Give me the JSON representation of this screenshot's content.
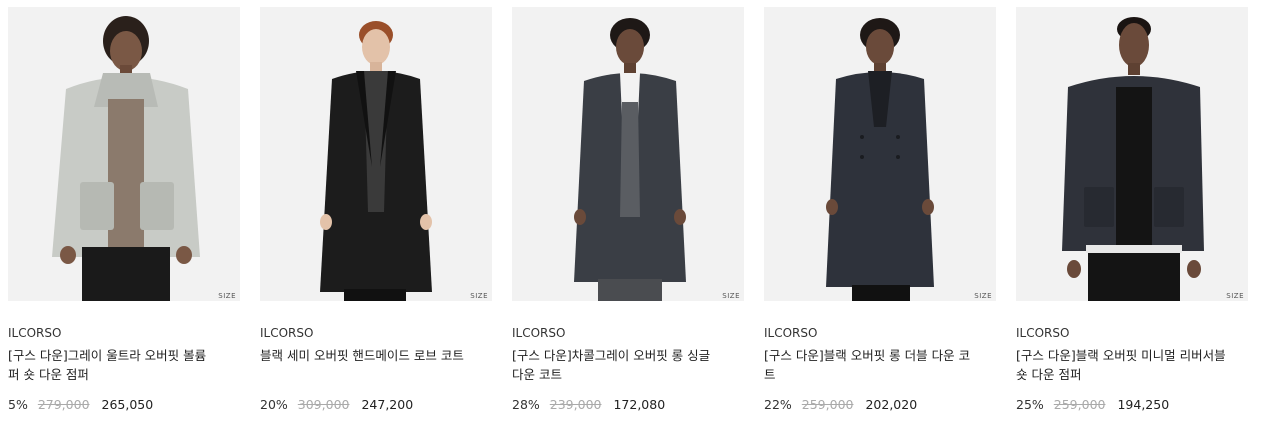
{
  "size_label": "SIZE",
  "products": [
    {
      "brand": "ILCORSO",
      "name": "[구스 다운]그레이 울트라 오버핏 볼륨 퍼 숏 다운 점퍼",
      "discount": "5%",
      "original_price": "279,000",
      "sale_price": "265,050",
      "garment_color": "#c8cbc6",
      "inner_color": "#8b7a6c",
      "type": "puffer"
    },
    {
      "brand": "ILCORSO",
      "name": "블랙 세미 오버핏 핸드메이드 로브 코트",
      "discount": "20%",
      "original_price": "309,000",
      "sale_price": "247,200",
      "garment_color": "#1c1c1c",
      "inner_color": "#3a3a3a",
      "type": "coat"
    },
    {
      "brand": "ILCORSO",
      "name": "[구스 다운]차콜그레이 오버핏 롱 싱글 다운 코트",
      "discount": "28%",
      "original_price": "239,000",
      "sale_price": "172,080",
      "garment_color": "#3a3e45",
      "inner_color": "#5a5d62",
      "type": "coat"
    },
    {
      "brand": "ILCORSO",
      "name": "[구스 다운]블랙 오버핏 롱 더블 다운 코트",
      "discount": "22%",
      "original_price": "259,000",
      "sale_price": "202,020",
      "garment_color": "#2e323b",
      "inner_color": "#1d1f24",
      "type": "coat"
    },
    {
      "brand": "ILCORSO",
      "name": "[구스 다운]블랙 오버핏 미니멀 리버서블 숏 다운 점퍼",
      "discount": "25%",
      "original_price": "259,000",
      "sale_price": "194,250",
      "garment_color": "#2f323a",
      "inner_color": "#141414",
      "type": "puffer"
    }
  ]
}
